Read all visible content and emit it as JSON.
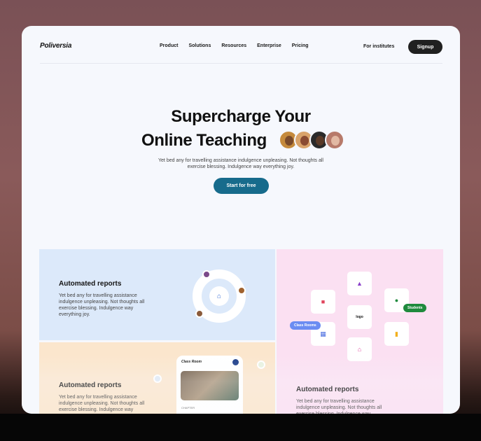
{
  "nav": {
    "brand": "Poliversia",
    "items": [
      "Product",
      "Solutions",
      "Resources",
      "Enterprise",
      "Pricing"
    ],
    "for_institutes": "For institutes",
    "signup": "Signup"
  },
  "hero": {
    "title_line1": "Supercharge Your",
    "title_line2": "Online Teaching",
    "subtitle": "Yet bed any for travelling assistance indulgence unpleasing. Not thoughts all exercise blessing. Indulgence way everything joy.",
    "cta": "Start for free"
  },
  "cards": {
    "reports1": {
      "title": "Automated reports",
      "desc": "Yet bed any for travelling assistance indulgence unpleasing. Not thoughts all exercise blessing. Indulgence way everything joy."
    },
    "reports2": {
      "title": "Automated reports",
      "desc": "Yet bed any for travelling assistance indulgence unpleasing. Not thoughts all exercise blessing. Indulgence way everything joy.",
      "pill_classrooms": "Class Rooms",
      "pill_students": "Students",
      "logo_tile": "logo"
    },
    "reports3": {
      "title": "Automated reports",
      "desc": "Yet bed any for travelling assistance indulgence unpleasing. Not thoughts all exercise blessing. Indulgence way everything joy.",
      "phone_title": "Class Room",
      "phone_caption": "CHAPTER"
    }
  },
  "colors": {
    "accent": "#176b8c",
    "blue_card": "#dce9fa",
    "pink_card": "#fbe0f2",
    "orange_card": "#fbe6cd",
    "signup_bg": "#202020",
    "students_pill": "#1f8a3d",
    "classrooms_pill": "#6b8cf2"
  }
}
